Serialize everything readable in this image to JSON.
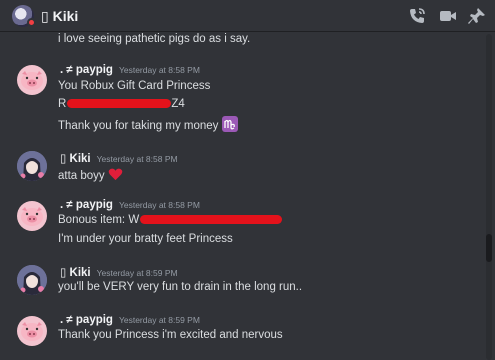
{
  "header": {
    "title": "▯ Kiki"
  },
  "messages": [
    {
      "text": "i love seeing pathetic pigs do as i say."
    },
    {
      "author": ". ≠ paypig",
      "time": "Yesterday at 8:58 PM",
      "lines": [
        "You Robux Gift Card Princess",
        "R",
        "Z4",
        "Thank you for taking my money"
      ]
    },
    {
      "author": "▯ Kiki",
      "time": "Yesterday at 8:58 PM",
      "lines": [
        "atta boyy"
      ]
    },
    {
      "author": ". ≠ paypig",
      "time": "Yesterday at 8:58 PM",
      "lines": [
        "Bonous item: W",
        "I'm under your bratty feet Princess"
      ]
    },
    {
      "author": "▯ Kiki",
      "time": "Yesterday at 8:59 PM",
      "lines": [
        "you'll be VERY very fun to drain in the long run.."
      ]
    },
    {
      "author": ". ≠ paypig",
      "time": "Yesterday at 8:59 PM",
      "lines": [
        "Thank you Princess i'm excited and nervous"
      ]
    }
  ],
  "colors": {
    "background": "#313338",
    "redaction": "#e4121b",
    "heart": "#e01e3a",
    "emoji_bg": "#9b59b6"
  }
}
